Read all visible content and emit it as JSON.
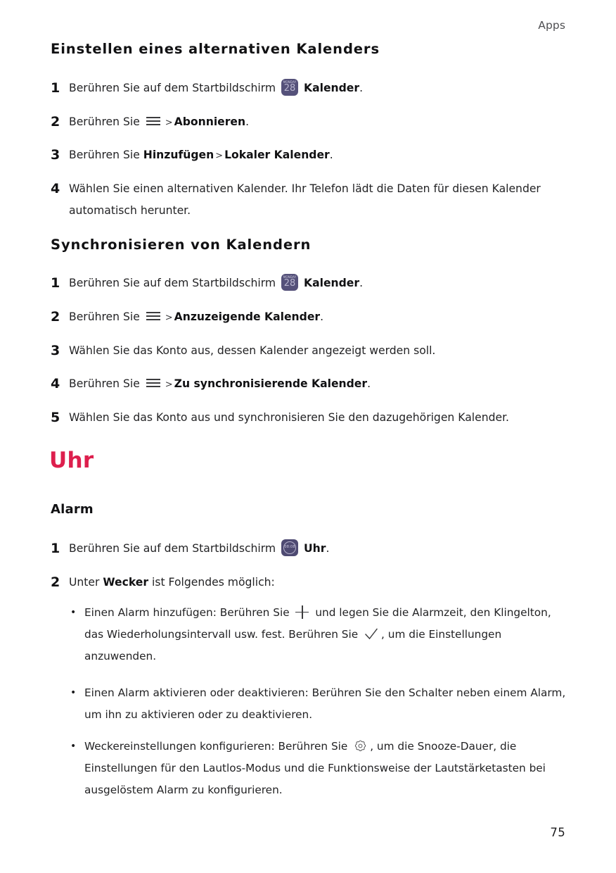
{
  "header": {
    "running_head": "Apps"
  },
  "sections": [
    {
      "heading": "Einstellen eines alternativen Kalenders",
      "steps": [
        {
          "num": "1",
          "pre": "Berühren Sie auf dem Startbildschirm ",
          "icon": "calendar-app-icon",
          "bold": "Kalender",
          "post": "."
        },
        {
          "num": "2",
          "pre": "Berühren Sie ",
          "icon": "hamburger-menu-icon",
          "sep": ">",
          "bold": "Abonnieren",
          "post": "."
        },
        {
          "num": "3",
          "pre": "Berühren Sie ",
          "bold": "Hinzufügen",
          "sep": ">",
          "bold2": "Lokaler Kalender",
          "post": "."
        },
        {
          "num": "4",
          "text": "Wählen Sie einen alternativen Kalender. Ihr Telefon lädt die Daten für diesen Kalender automatisch herunter."
        }
      ]
    },
    {
      "heading": "Synchronisieren von Kalendern",
      "steps": [
        {
          "num": "1",
          "pre": "Berühren Sie auf dem Startbildschirm ",
          "icon": "calendar-app-icon",
          "bold": "Kalender",
          "post": "."
        },
        {
          "num": "2",
          "pre": "Berühren Sie ",
          "icon": "hamburger-menu-icon",
          "sep": ">",
          "bold": "Anzuzeigende Kalender",
          "post": "."
        },
        {
          "num": "3",
          "text": "Wählen Sie das Konto aus, dessen Kalender angezeigt werden soll."
        },
        {
          "num": "4",
          "pre": "Berühren Sie ",
          "icon": "hamburger-menu-icon",
          "sep": ">",
          "bold": "Zu synchronisierende Kalender",
          "post": "."
        },
        {
          "num": "5",
          "text": "Wählen Sie das Konto aus und synchronisieren Sie den dazugehörigen Kalender."
        }
      ]
    }
  ],
  "clock_chapter": {
    "title": "Uhr",
    "title_color": "#dd1f4d",
    "subheading": "Alarm",
    "steps": [
      {
        "num": "1",
        "pre": "Berühren Sie auf dem Startbildschirm ",
        "icon": "clock-app-icon",
        "bold": "Uhr",
        "post": "."
      },
      {
        "num": "2",
        "pre": "Unter ",
        "bold": "Wecker",
        "post": " ist Folgendes möglich:"
      }
    ],
    "bullets": [
      {
        "part1": "Einen Alarm hinzufügen: Berühren Sie ",
        "icon1": "plus-icon",
        "part2": " und legen Sie die Alarmzeit, den Klingelton, das Wiederholungsintervall usw. fest. Berühren Sie ",
        "icon2": "check-icon",
        "part3": ", um die Einstellungen anzuwenden."
      },
      {
        "part1": "Einen Alarm aktivieren oder deaktivieren: Berühren Sie den Schalter neben einem Alarm, um ihn zu aktivieren oder zu deaktivieren."
      },
      {
        "part1": "Weckereinstellungen konfigurieren: Berühren Sie ",
        "icon1": "gear-icon",
        "part2": ", um die Snooze-Dauer, die Einstellungen für den Lautlos-Modus und die Funktionsweise der Lautstärketasten bei ausgelöstem Alarm zu konfigurieren."
      }
    ]
  },
  "icons": {
    "calendar_top_label": "MONDAY",
    "calendar_day": "28",
    "clock_digits": "08:08",
    "bullet_glyph": "•",
    "separator_glyph": ">"
  },
  "footer": {
    "page_number": "75"
  }
}
